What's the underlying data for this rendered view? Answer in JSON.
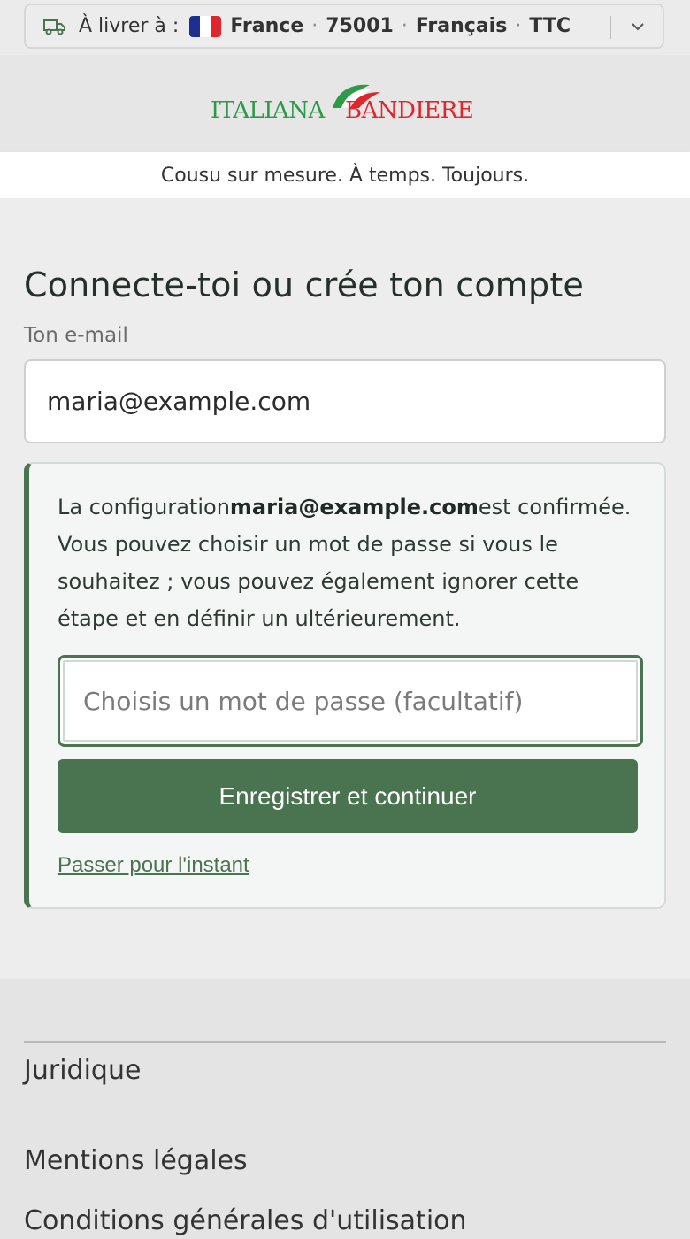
{
  "delivery": {
    "label": "À livrer à :",
    "country": "France",
    "postal_code": "75001",
    "language": "Français",
    "tax_mode": "TTC",
    "flag_colors": [
      "#1d2f8f",
      "#ffffff",
      "#e0262d"
    ],
    "icon": "truck-icon"
  },
  "brand": {
    "logo_left": "ITALIANA",
    "logo_right": "BANDIERE",
    "green": "#2e9a48",
    "red": "#e0262d"
  },
  "tagline": "Cousu sur mesure. À temps. Toujours.",
  "login": {
    "title": "Connecte-toi ou crée ton compte",
    "email_label": "Ton e-mail",
    "email_value": "maria@example.com"
  },
  "confirmation": {
    "text_before": "La configuration",
    "email": "maria@example.com",
    "text_after": "est confirmée. Vous pouvez choisir un mot de passe si vous le souhaitez ; vous pouvez également ignorer cette étape et en définir un ultérieurement.",
    "password_placeholder": "Choisis un mot de passe (facultatif)",
    "save_label": "Enregistrer et continuer",
    "skip_label": "Passer pour l'instant",
    "accent": "#4a7350"
  },
  "footer": {
    "heading": "Juridique",
    "links": [
      "Mentions légales",
      "Conditions générales d'utilisation"
    ]
  }
}
